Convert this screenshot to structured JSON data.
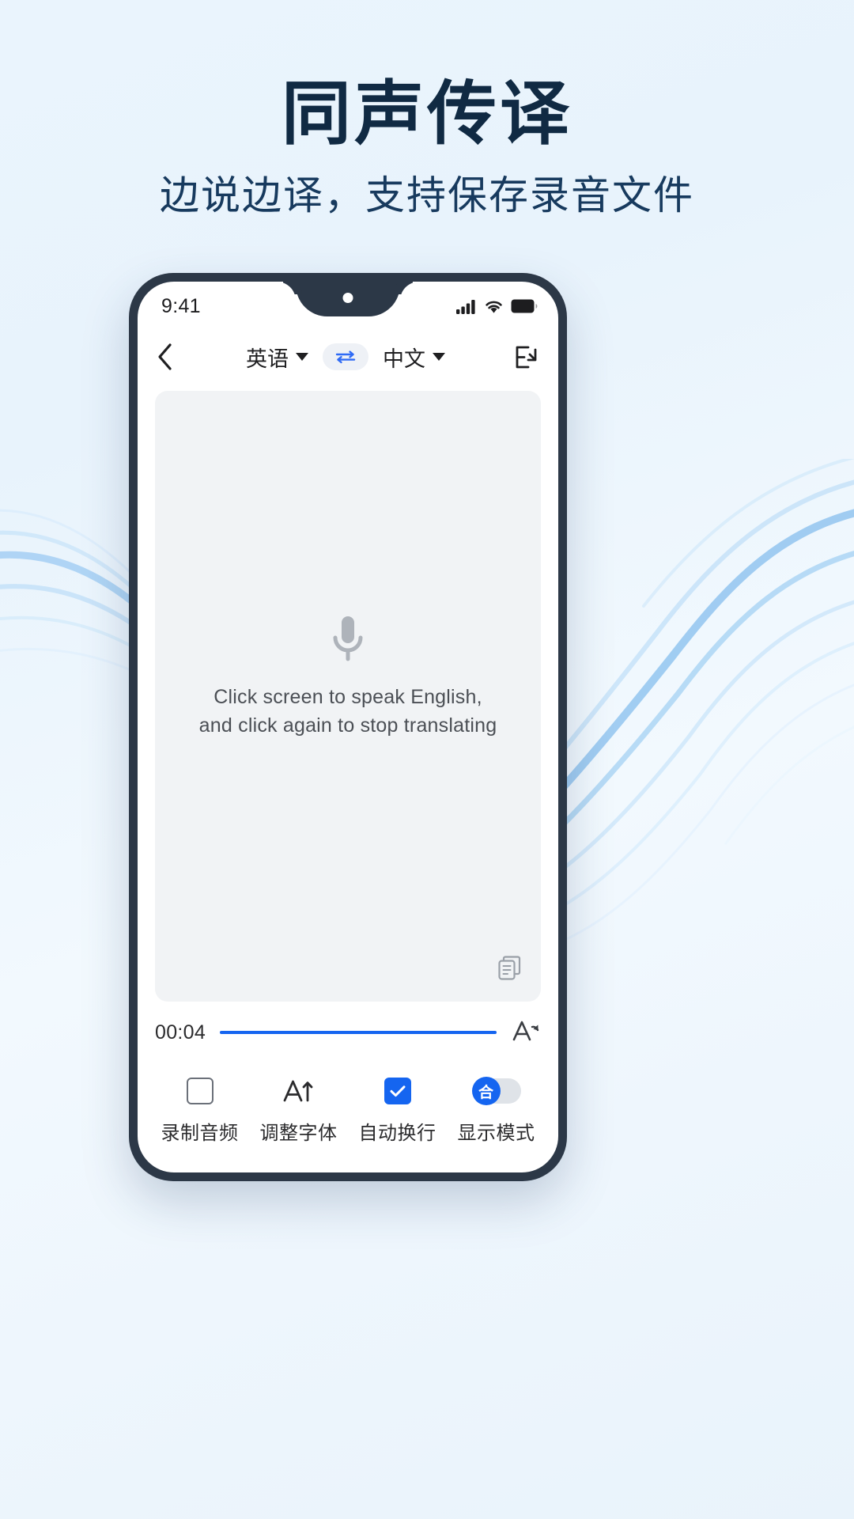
{
  "page": {
    "title": "同声传译",
    "subtitle": "边说边译，支持保存录音文件",
    "accent_color": "#1565f0",
    "title_color": "#102a43",
    "background_color": "#eaf4fd"
  },
  "phone": {
    "status_bar": {
      "time": "9:41",
      "icons": [
        "signal-icon",
        "wifi-icon",
        "battery-icon"
      ]
    },
    "nav_bar": {
      "back_icon": "chevron-left-icon",
      "source_language": "英语",
      "target_language": "中文",
      "swap_icon": "swap-horizontal-icon",
      "right_icon": "text-import-icon"
    },
    "content": {
      "mic_icon": "microphone-icon",
      "hint": "Click screen to speak English,\nand click again to stop translating",
      "copy_icon": "copy-icon"
    },
    "timer": {
      "elapsed": "00:04",
      "progress_percent": 100,
      "font_icon": "font-size-icon"
    },
    "toolbar": [
      {
        "label": "录制音频",
        "icon": "checkbox-unchecked-icon",
        "state": "off"
      },
      {
        "label": "调整字体",
        "icon": "font-adjust-icon",
        "state": "none"
      },
      {
        "label": "自动换行",
        "icon": "checkbox-checked-icon",
        "state": "on"
      },
      {
        "label": "显示模式",
        "icon": "display-mode-toggle-icon",
        "state": "merged"
      }
    ]
  }
}
